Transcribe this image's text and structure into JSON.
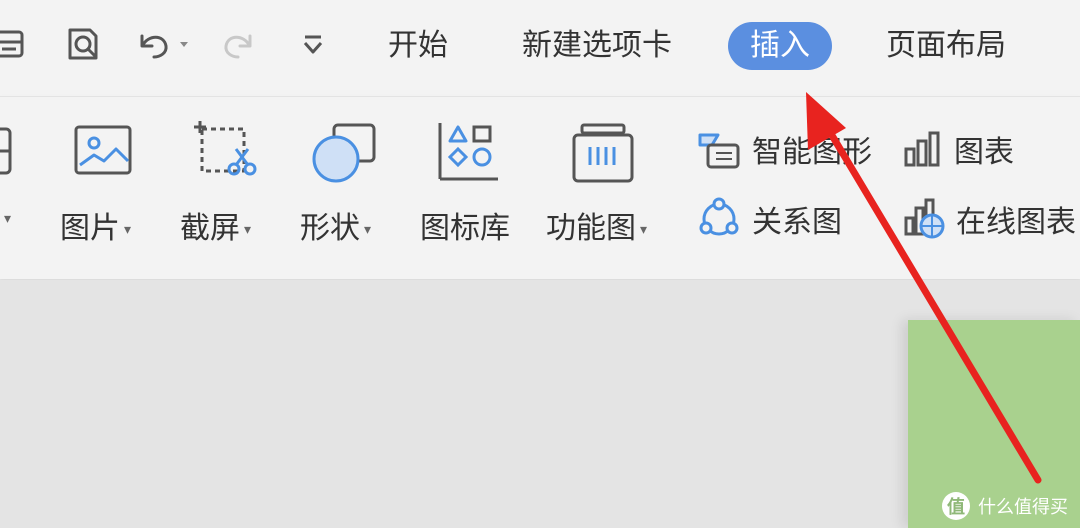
{
  "quick_access": {
    "icons": [
      "print-icon",
      "print-preview-icon",
      "undo-icon",
      "redo-icon",
      "customize-toolbar-icon"
    ]
  },
  "tabs": [
    {
      "label": "开始",
      "active": false
    },
    {
      "label": "新建选项卡",
      "active": false
    },
    {
      "label": "插入",
      "active": true
    },
    {
      "label": "页面布局",
      "active": false
    }
  ],
  "ribbon": {
    "tools": [
      {
        "label": "图片",
        "icon": "picture-icon",
        "has_dropdown": true
      },
      {
        "label": "截屏",
        "icon": "screenshot-icon",
        "has_dropdown": true
      },
      {
        "label": "形状",
        "icon": "shapes-icon",
        "has_dropdown": true
      },
      {
        "label": "图标库",
        "icon": "icon-library-icon",
        "has_dropdown": false
      },
      {
        "label": "功能图",
        "icon": "function-chart-icon",
        "has_dropdown": true
      }
    ],
    "small_tools": [
      {
        "label": "智能图形",
        "icon": "smart-graphic-icon"
      },
      {
        "label": "关系图",
        "icon": "relationship-chart-icon"
      },
      {
        "label": "图表",
        "icon": "chart-icon"
      },
      {
        "label": "在线图表",
        "icon": "online-chart-icon"
      }
    ]
  },
  "watermark": {
    "badge": "值",
    "text": "什么值得买"
  },
  "colors": {
    "active_tab": "#5b8fe0",
    "slide": "#a9d18e",
    "annotation_arrow": "#e8231f",
    "icon_blue": "#4a90e2"
  }
}
